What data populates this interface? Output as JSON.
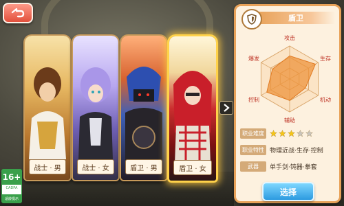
{
  "header": {
    "back_icon": "back-arrow-icon"
  },
  "characters": [
    {
      "label": "战士 · 男",
      "selected": false
    },
    {
      "label": "战士 · 女",
      "selected": false
    },
    {
      "label": "盾卫 · 男",
      "selected": false
    },
    {
      "label": "盾卫 · 女",
      "selected": true
    }
  ],
  "next_icon": "chevron-right-icon",
  "panel": {
    "class_icon": "shield-icon",
    "class_name": "盾卫",
    "radar": {
      "axes": [
        "攻击",
        "生存",
        "机动",
        "辅助",
        "控制",
        "爆发"
      ],
      "values": [
        0.7,
        0.9,
        0.55,
        0.65,
        0.8,
        0.6
      ]
    },
    "difficulty_label": "职业难度",
    "difficulty_stars": 3,
    "difficulty_max": 5,
    "trait_label": "职业特性",
    "trait_value": "物理近战·生存·控制",
    "weapon_label": "武器",
    "weapon_value": "单手剑·钝器·拳套",
    "select_label": "选择"
  },
  "age_rating": {
    "rating": "16+",
    "code": "CADPA",
    "note": "适龄提示"
  },
  "colors": {
    "accent": "#e8a259",
    "select_button": "#2c9ae0",
    "star": "#f5c518",
    "rating": "#3aa04b"
  }
}
